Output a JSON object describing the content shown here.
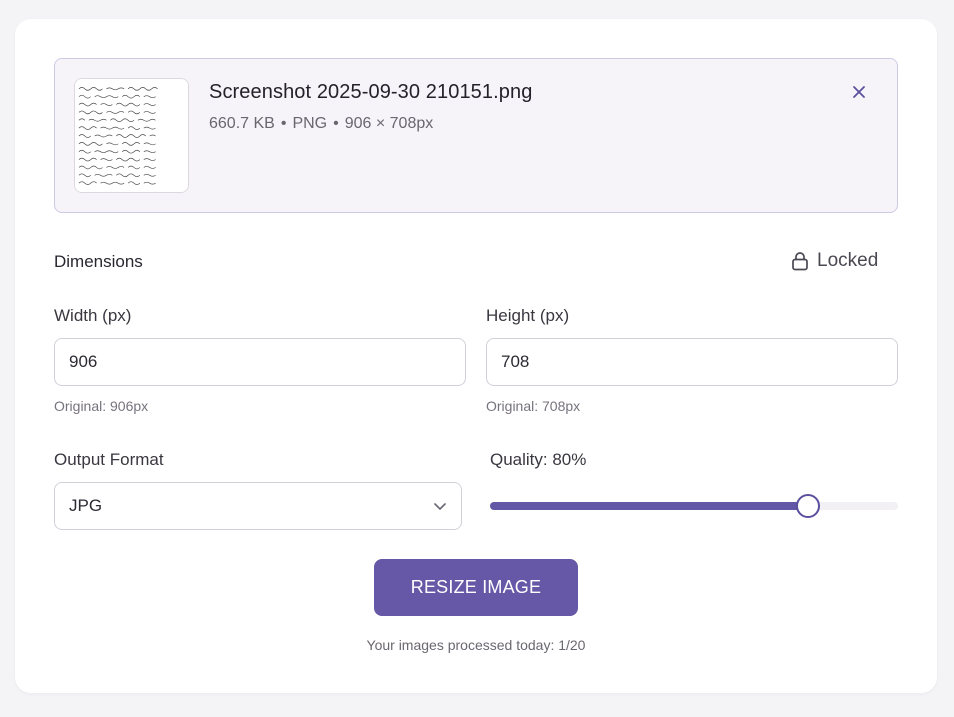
{
  "file": {
    "name": "Screenshot 2025-09-30 210151.png",
    "size": "660.7 KB",
    "separator": "•",
    "type": "PNG",
    "dimensions": "906 × 708px",
    "close_icon": "close-icon",
    "thumbnail_icon": "handwriting-thumbnail"
  },
  "dimensions": {
    "title": "Dimensions",
    "lock_label": "Locked",
    "lock_icon": "lock-icon",
    "width": {
      "label": "Width (px)",
      "value": "906",
      "hint": "Original: 906px"
    },
    "height": {
      "label": "Height (px)",
      "value": "708",
      "hint": "Original: 708px"
    }
  },
  "output": {
    "format_label": "Output Format",
    "format_value": "JPG",
    "format_icon": "chevron-down-icon",
    "quality_label": "Quality: 80%",
    "quality_value": 0.8
  },
  "actions": {
    "resize_label": "RESIZE IMAGE"
  },
  "footer": {
    "usage_note": "Your images processed today: 1/20"
  },
  "colors": {
    "accent": "#6658a6",
    "file_box_bg": "#f6f4f8",
    "file_box_border": "#cfc9e4"
  }
}
